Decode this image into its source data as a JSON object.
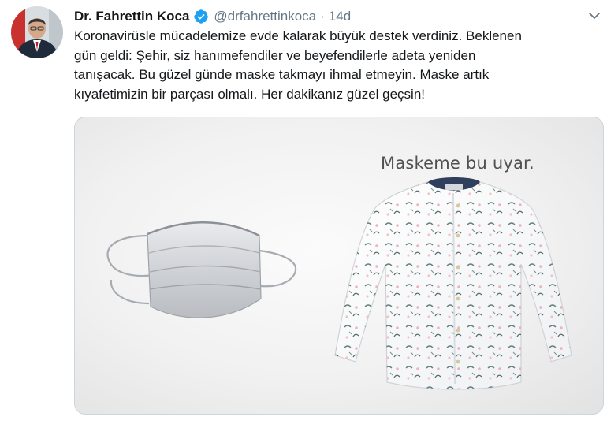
{
  "tweet": {
    "author_name": "Dr. Fahrettin Koca",
    "handle": "@drfahrettinkoca",
    "separator": "·",
    "time": "14d",
    "text_lines": [
      "Koronavirüsle mücadelemize evde kalarak büyük destek verdiniz. Beklenen",
      "gün geldi: Şehir, siz hanımefendiler ve beyefendilerle adeta yeniden",
      "tanışacak. Bu güzel günde maske takmayı ihmal etmeyin. Maske artık",
      "kıyafetimizin bir parçası olmalı. Her dakikanız güzel geçsin!"
    ],
    "media": {
      "caption": "Maskeme bu uyar."
    }
  },
  "icons": {
    "verified": "verified-badge-icon",
    "caret": "chevron-down-icon"
  },
  "colors": {
    "verified_blue": "#1da1f2",
    "secondary_text": "#657786",
    "border": "#ccd6dd"
  }
}
